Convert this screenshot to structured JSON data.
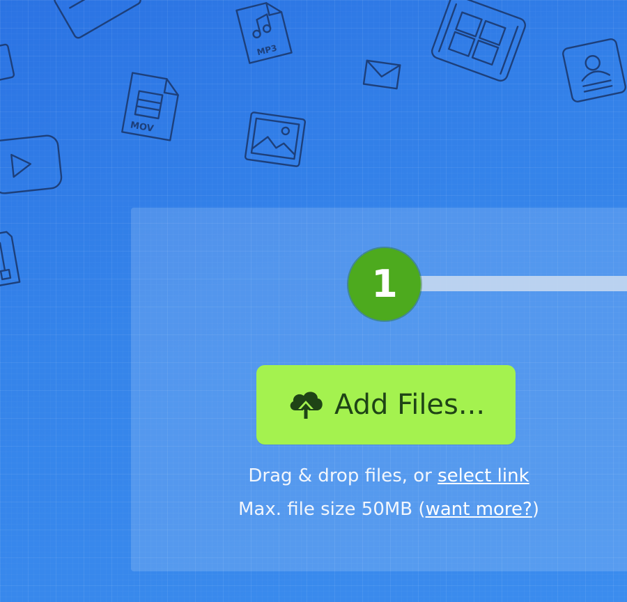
{
  "decorations": {
    "mp3_label": "MP3",
    "mov_label": "MOV"
  },
  "step": {
    "number": "1"
  },
  "upload": {
    "button_label": "Add Files...",
    "drag_text": "Drag & drop files, or ",
    "select_link": "select link",
    "max_size_text": "Max. file size 50MB (",
    "want_more_link": "want more?",
    "max_size_close": ")"
  }
}
